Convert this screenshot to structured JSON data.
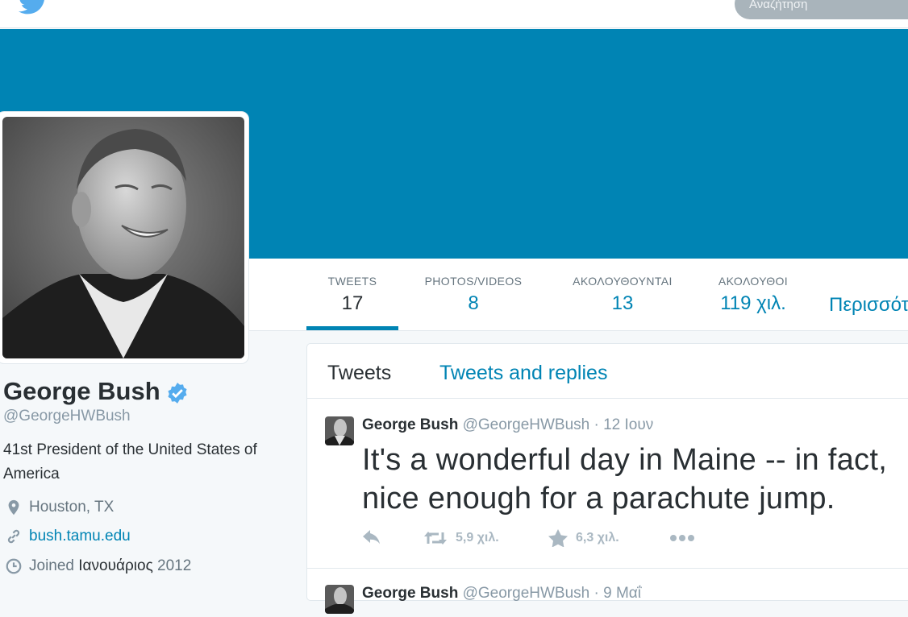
{
  "search": {
    "placeholder": "Αναζήτηση"
  },
  "nav": {
    "stats": [
      {
        "label": "TWEETS",
        "value": "17"
      },
      {
        "label": "PHOTOS/VIDEOS",
        "value": "8"
      },
      {
        "label": "ΑΚΟΛΟΥΘΟΥΝΤΑΙ",
        "value": "13"
      },
      {
        "label": "ΑΚΟΛΟΥΘΟΙ",
        "value": "119 χιλ."
      }
    ],
    "more": "Περισσότερα"
  },
  "profile": {
    "name": "George Bush",
    "handle": "@GeorgeHWBush",
    "bio": "41st President of the United States of America",
    "location": "Houston, TX",
    "website": "bush.tamu.edu",
    "joined_prefix": "Joined",
    "joined_month": "Ιανουάριος",
    "joined_year": "2012"
  },
  "timeline": {
    "tabs": {
      "tweets": "Tweets",
      "replies": "Tweets and replies"
    },
    "tweets": [
      {
        "name": "George Bush",
        "handle": "@GeorgeHWBush",
        "time": "· 12 Ιουν",
        "line1": "It's a wonderful day in Maine -- in fact,",
        "line2": "nice enough for a parachute jump.",
        "retweets": "5,9 χιλ.",
        "favorites": "6,3 χιλ."
      },
      {
        "name": "George Bush",
        "handle": "@GeorgeHWBush",
        "time": "· 9 Μαΐ"
      }
    ]
  },
  "colors": {
    "brand": "#0084b4",
    "header": "#0084b4",
    "verified": "#55acee"
  }
}
